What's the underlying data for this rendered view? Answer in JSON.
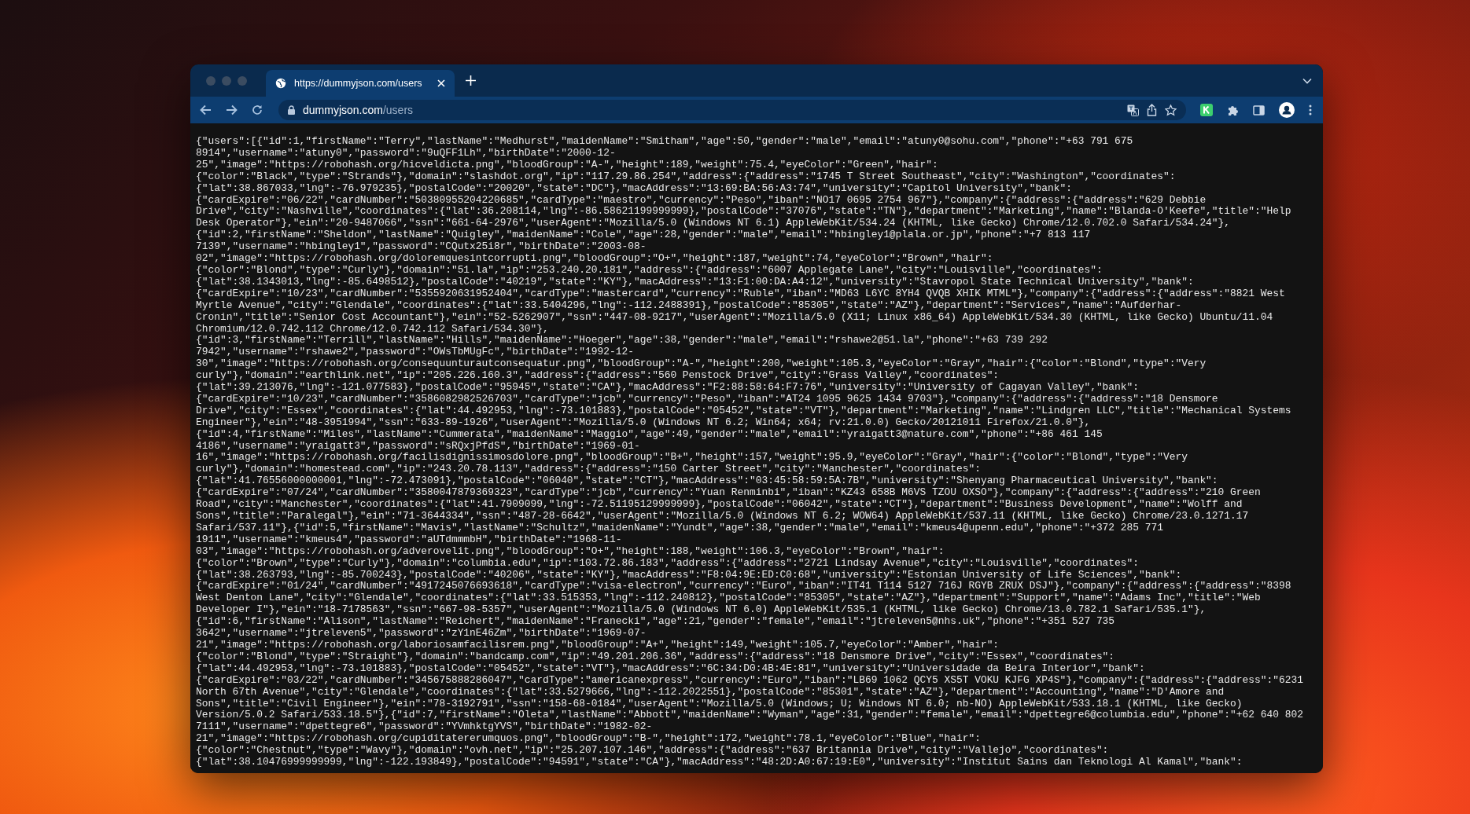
{
  "tab": {
    "title": "https://dummyjson.com/users"
  },
  "address_bar": {
    "host": "dummyjson.com",
    "path": "/users"
  },
  "json_lines": [
    "{\"users\":[{\"id\":1,\"firstName\":\"Terry\",\"lastName\":\"Medhurst\",\"maidenName\":\"Smitham\",\"age\":50,\"gender\":\"male\",\"email\":\"atuny0@sohu.com\",\"phone\":\"+63 791 675",
    "8914\",\"username\":\"atuny0\",\"password\":\"9uQFF1Lh\",\"birthDate\":\"2000-12-",
    "25\",\"image\":\"https://robohash.org/hicveldicta.png\",\"bloodGroup\":\"A-\",\"height\":189,\"weight\":75.4,\"eyeColor\":\"Green\",\"hair\":",
    "{\"color\":\"Black\",\"type\":\"Strands\"},\"domain\":\"slashdot.org\",\"ip\":\"117.29.86.254\",\"address\":{\"address\":\"1745 T Street Southeast\",\"city\":\"Washington\",\"coordinates\":",
    "{\"lat\":38.867033,\"lng\":-76.979235},\"postalCode\":\"20020\",\"state\":\"DC\"},\"macAddress\":\"13:69:BA:56:A3:74\",\"university\":\"Capitol University\",\"bank\":",
    "{\"cardExpire\":\"06/22\",\"cardNumber\":\"50380955204220685\",\"cardType\":\"maestro\",\"currency\":\"Peso\",\"iban\":\"NO17 0695 2754 967\"},\"company\":{\"address\":{\"address\":\"629 Debbie",
    "Drive\",\"city\":\"Nashville\",\"coordinates\":{\"lat\":36.208114,\"lng\":-86.58621199999999},\"postalCode\":\"37076\",\"state\":\"TN\"},\"department\":\"Marketing\",\"name\":\"Blanda-O'Keefe\",\"title\":\"Help",
    "Desk Operator\"},\"ein\":\"20-9487066\",\"ssn\":\"661-64-2976\",\"userAgent\":\"Mozilla/5.0 (Windows NT 6.1) AppleWebKit/534.24 (KHTML, like Gecko) Chrome/12.0.702.0 Safari/534.24\"},",
    "{\"id\":2,\"firstName\":\"Sheldon\",\"lastName\":\"Quigley\",\"maidenName\":\"Cole\",\"age\":28,\"gender\":\"male\",\"email\":\"hbingley1@plala.or.jp\",\"phone\":\"+7 813 117",
    "7139\",\"username\":\"hbingley1\",\"password\":\"CQutx25i8r\",\"birthDate\":\"2003-08-",
    "02\",\"image\":\"https://robohash.org/doloremquesintcorrupti.png\",\"bloodGroup\":\"O+\",\"height\":187,\"weight\":74,\"eyeColor\":\"Brown\",\"hair\":",
    "{\"color\":\"Blond\",\"type\":\"Curly\"},\"domain\":\"51.la\",\"ip\":\"253.240.20.181\",\"address\":{\"address\":\"6007 Applegate Lane\",\"city\":\"Louisville\",\"coordinates\":",
    "{\"lat\":38.1343013,\"lng\":-85.6498512},\"postalCode\":\"40219\",\"state\":\"KY\"},\"macAddress\":\"13:F1:00:DA:A4:12\",\"university\":\"Stavropol State Technical University\",\"bank\":",
    "{\"cardExpire\":\"10/23\",\"cardNumber\":\"5355920631952404\",\"cardType\":\"mastercard\",\"currency\":\"Ruble\",\"iban\":\"MD63 L6YC 8YH4 QVQB XHIK MTML\"},\"company\":{\"address\":{\"address\":\"8821 West",
    "Myrtle Avenue\",\"city\":\"Glendale\",\"coordinates\":{\"lat\":33.5404296,\"lng\":-112.2488391},\"postalCode\":\"85305\",\"state\":\"AZ\"},\"department\":\"Services\",\"name\":\"Aufderhar-",
    "Cronin\",\"title\":\"Senior Cost Accountant\"},\"ein\":\"52-5262907\",\"ssn\":\"447-08-9217\",\"userAgent\":\"Mozilla/5.0 (X11; Linux x86_64) AppleWebKit/534.30 (KHTML, like Gecko) Ubuntu/11.04",
    "Chromium/12.0.742.112 Chrome/12.0.742.112 Safari/534.30\"},",
    "{\"id\":3,\"firstName\":\"Terrill\",\"lastName\":\"Hills\",\"maidenName\":\"Hoeger\",\"age\":38,\"gender\":\"male\",\"email\":\"rshawe2@51.la\",\"phone\":\"+63 739 292",
    "7942\",\"username\":\"rshawe2\",\"password\":\"OWsTbMUgFc\",\"birthDate\":\"1992-12-",
    "30\",\"image\":\"https://robohash.org/consequunturautconsequatur.png\",\"bloodGroup\":\"A-\",\"height\":200,\"weight\":105.3,\"eyeColor\":\"Gray\",\"hair\":{\"color\":\"Blond\",\"type\":\"Very",
    "curly\"},\"domain\":\"earthlink.net\",\"ip\":\"205.226.160.3\",\"address\":{\"address\":\"560 Penstock Drive\",\"city\":\"Grass Valley\",\"coordinates\":",
    "{\"lat\":39.213076,\"lng\":-121.077583},\"postalCode\":\"95945\",\"state\":\"CA\"},\"macAddress\":\"F2:88:58:64:F7:76\",\"university\":\"University of Cagayan Valley\",\"bank\":",
    "{\"cardExpire\":\"10/23\",\"cardNumber\":\"3586082982526703\",\"cardType\":\"jcb\",\"currency\":\"Peso\",\"iban\":\"AT24 1095 9625 1434 9703\"},\"company\":{\"address\":{\"address\":\"18 Densmore",
    "Drive\",\"city\":\"Essex\",\"coordinates\":{\"lat\":44.492953,\"lng\":-73.101883},\"postalCode\":\"05452\",\"state\":\"VT\"},\"department\":\"Marketing\",\"name\":\"Lindgren LLC\",\"title\":\"Mechanical Systems",
    "Engineer\"},\"ein\":\"48-3951994\",\"ssn\":\"633-89-1926\",\"userAgent\":\"Mozilla/5.0 (Windows NT 6.2; Win64; x64; rv:21.0.0) Gecko/20121011 Firefox/21.0.0\"},",
    "{\"id\":4,\"firstName\":\"Miles\",\"lastName\":\"Cummerata\",\"maidenName\":\"Maggio\",\"age\":49,\"gender\":\"male\",\"email\":\"yraigatt3@nature.com\",\"phone\":\"+86 461 145",
    "4186\",\"username\":\"yraigatt3\",\"password\":\"sRQxjPfdS\",\"birthDate\":\"1969-01-",
    "16\",\"image\":\"https://robohash.org/facilisdignissimosdolore.png\",\"bloodGroup\":\"B+\",\"height\":157,\"weight\":95.9,\"eyeColor\":\"Gray\",\"hair\":{\"color\":\"Blond\",\"type\":\"Very",
    "curly\"},\"domain\":\"homestead.com\",\"ip\":\"243.20.78.113\",\"address\":{\"address\":\"150 Carter Street\",\"city\":\"Manchester\",\"coordinates\":",
    "{\"lat\":41.76556000000001,\"lng\":-72.473091},\"postalCode\":\"06040\",\"state\":\"CT\"},\"macAddress\":\"03:45:58:59:5A:7B\",\"university\":\"Shenyang Pharmaceutical University\",\"bank\":",
    "{\"cardExpire\":\"07/24\",\"cardNumber\":\"3580047879369323\",\"cardType\":\"jcb\",\"currency\":\"Yuan Renminbi\",\"iban\":\"KZ43 658B M6VS TZOU OXSO\"},\"company\":{\"address\":{\"address\":\"210 Green",
    "Road\",\"city\":\"Manchester\",\"coordinates\":{\"lat\":41.7909099,\"lng\":-72.51195129999999},\"postalCode\":\"06042\",\"state\":\"CT\"},\"department\":\"Business Development\",\"name\":\"Wolff and",
    "Sons\",\"title\":\"Paralegal\"},\"ein\":\"71-3644334\",\"ssn\":\"487-28-6642\",\"userAgent\":\"Mozilla/5.0 (Windows NT 6.2; WOW64) AppleWebKit/537.11 (KHTML, like Gecko) Chrome/23.0.1271.17",
    "Safari/537.11\"},{\"id\":5,\"firstName\":\"Mavis\",\"lastName\":\"Schultz\",\"maidenName\":\"Yundt\",\"age\":38,\"gender\":\"male\",\"email\":\"kmeus4@upenn.edu\",\"phone\":\"+372 285 771",
    "1911\",\"username\":\"kmeus4\",\"password\":\"aUTdmmmbH\",\"birthDate\":\"1968-11-",
    "03\",\"image\":\"https://robohash.org/adverovelit.png\",\"bloodGroup\":\"O+\",\"height\":188,\"weight\":106.3,\"eyeColor\":\"Brown\",\"hair\":",
    "{\"color\":\"Brown\",\"type\":\"Curly\"},\"domain\":\"columbia.edu\",\"ip\":\"103.72.86.183\",\"address\":{\"address\":\"2721 Lindsay Avenue\",\"city\":\"Louisville\",\"coordinates\":",
    "{\"lat\":38.263793,\"lng\":-85.700243},\"postalCode\":\"40206\",\"state\":\"KY\"},\"macAddress\":\"F8:04:9E:ED:C0:68\",\"university\":\"Estonian University of Life Sciences\",\"bank\":",
    "{\"cardExpire\":\"01/24\",\"cardNumber\":\"4917245076693618\",\"cardType\":\"visa-electron\",\"currency\":\"Euro\",\"iban\":\"IT41 T114 5127 716J RGYB ZRUX DSJ\"},\"company\":{\"address\":{\"address\":\"8398",
    "West Denton Lane\",\"city\":\"Glendale\",\"coordinates\":{\"lat\":33.515353,\"lng\":-112.240812},\"postalCode\":\"85305\",\"state\":\"AZ\"},\"department\":\"Support\",\"name\":\"Adams Inc\",\"title\":\"Web",
    "Developer I\"},\"ein\":\"18-7178563\",\"ssn\":\"667-98-5357\",\"userAgent\":\"Mozilla/5.0 (Windows NT 6.0) AppleWebKit/535.1 (KHTML, like Gecko) Chrome/13.0.782.1 Safari/535.1\"},",
    "{\"id\":6,\"firstName\":\"Alison\",\"lastName\":\"Reichert\",\"maidenName\":\"Franecki\",\"age\":21,\"gender\":\"female\",\"email\":\"jtreleven5@nhs.uk\",\"phone\":\"+351 527 735",
    "3642\",\"username\":\"jtreleven5\",\"password\":\"zY1nE46Zm\",\"birthDate\":\"1969-07-",
    "21\",\"image\":\"https://robohash.org/laboriosamfacilisrem.png\",\"bloodGroup\":\"A+\",\"height\":149,\"weight\":105.7,\"eyeColor\":\"Amber\",\"hair\":",
    "{\"color\":\"Blond\",\"type\":\"Straight\"},\"domain\":\"bandcamp.com\",\"ip\":\"49.201.206.36\",\"address\":{\"address\":\"18 Densmore Drive\",\"city\":\"Essex\",\"coordinates\":",
    "{\"lat\":44.492953,\"lng\":-73.101883},\"postalCode\":\"05452\",\"state\":\"VT\"},\"macAddress\":\"6C:34:D0:4B:4E:81\",\"university\":\"Universidade da Beira Interior\",\"bank\":",
    "{\"cardExpire\":\"03/22\",\"cardNumber\":\"345675888286047\",\"cardType\":\"americanexpress\",\"currency\":\"Euro\",\"iban\":\"LB69 1062 QCY5 XS5T VOKU KJFG XP4S\"},\"company\":{\"address\":{\"address\":\"6231",
    "North 67th Avenue\",\"city\":\"Glendale\",\"coordinates\":{\"lat\":33.5279666,\"lng\":-112.2022551},\"postalCode\":\"85301\",\"state\":\"AZ\"},\"department\":\"Accounting\",\"name\":\"D'Amore and",
    "Sons\",\"title\":\"Civil Engineer\"},\"ein\":\"78-3192791\",\"ssn\":\"158-68-0184\",\"userAgent\":\"Mozilla/5.0 (Windows; U; Windows NT 6.0; nb-NO) AppleWebKit/533.18.1 (KHTML, like Gecko)",
    "Version/5.0.2 Safari/533.18.5\"},{\"id\":7,\"firstName\":\"Oleta\",\"lastName\":\"Abbott\",\"maidenName\":\"Wyman\",\"age\":31,\"gender\":\"female\",\"email\":\"dpettegre6@columbia.edu\",\"phone\":\"+62 640 802",
    "7111\",\"username\":\"dpettegre6\",\"password\":\"YVmhktgYVS\",\"birthDate\":\"1982-02-",
    "21\",\"image\":\"https://robohash.org/cupiditatererumquos.png\",\"bloodGroup\":\"B-\",\"height\":172,\"weight\":78.1,\"eyeColor\":\"Blue\",\"hair\":",
    "{\"color\":\"Chestnut\",\"type\":\"Wavy\"},\"domain\":\"ovh.net\",\"ip\":\"25.207.107.146\",\"address\":{\"address\":\"637 Britannia Drive\",\"city\":\"Vallejo\",\"coordinates\":",
    "{\"lat\":38.10476999999999,\"lng\":-122.193849},\"postalCode\":\"94591\",\"state\":\"CA\"},\"macAddress\":\"48:2D:A0:67:19:E0\",\"university\":\"Institut Sains dan Teknologi Al Kamal\",\"bank\":"
  ]
}
